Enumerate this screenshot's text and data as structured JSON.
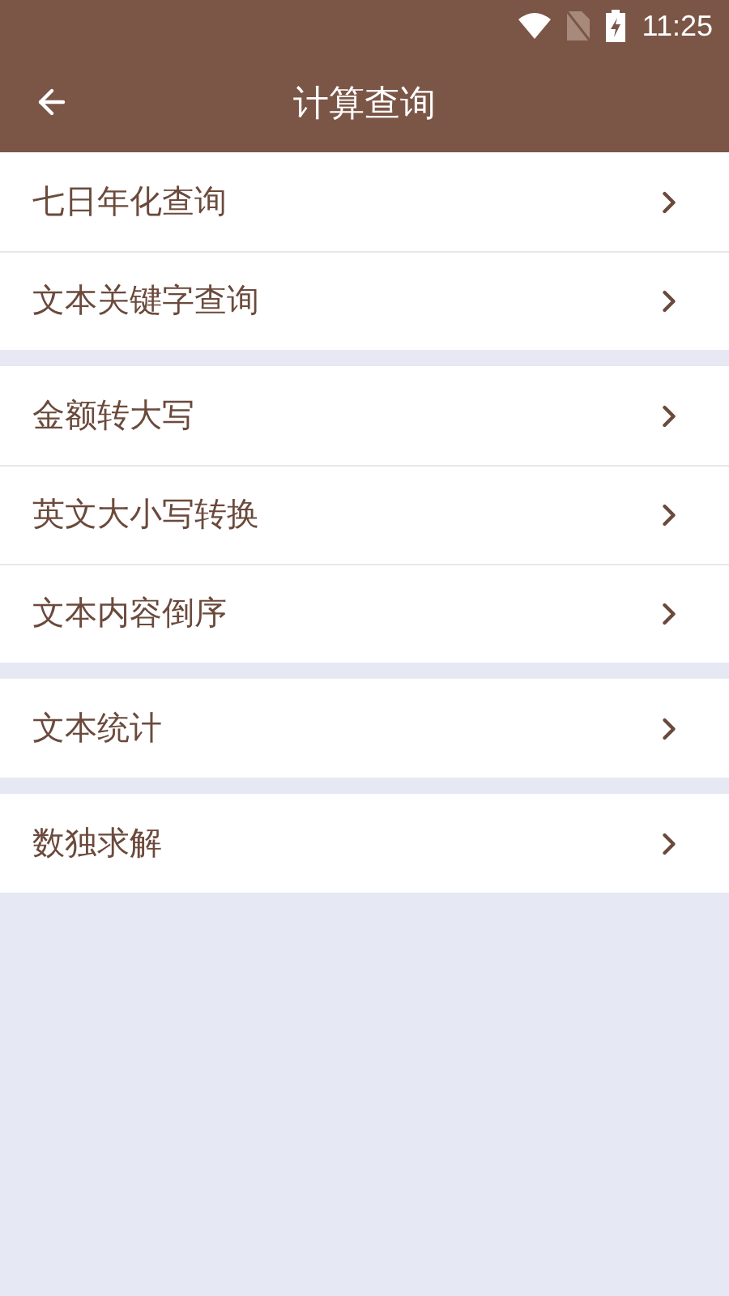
{
  "status_bar": {
    "time": "11:25"
  },
  "header": {
    "title": "计算查询"
  },
  "groups": [
    {
      "items": [
        {
          "label": "七日年化查询"
        },
        {
          "label": "文本关键字查询"
        }
      ]
    },
    {
      "items": [
        {
          "label": "金额转大写"
        },
        {
          "label": "英文大小写转换"
        },
        {
          "label": "文本内容倒序"
        }
      ]
    },
    {
      "items": [
        {
          "label": "文本统计"
        }
      ]
    },
    {
      "items": [
        {
          "label": "数独求解"
        }
      ]
    }
  ]
}
